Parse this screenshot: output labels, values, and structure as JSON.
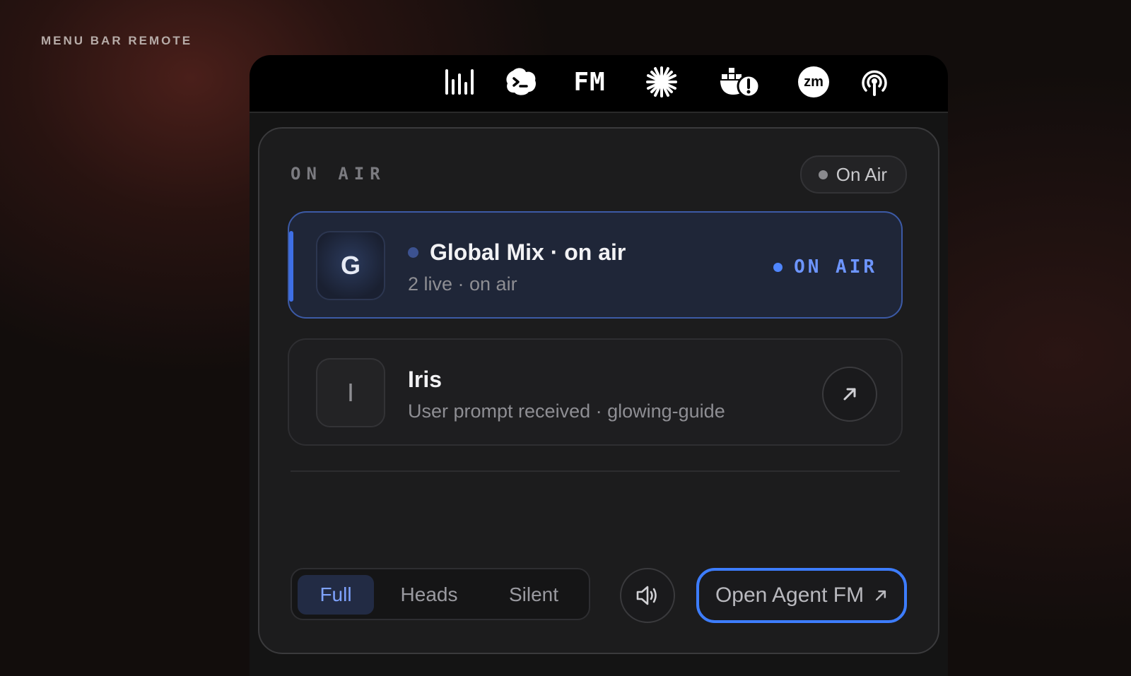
{
  "page_label": "MENU BAR REMOTE",
  "menubar": {
    "icons": [
      "audio-levels-icon",
      "terminal-cloud-icon",
      "fm-logo-icon",
      "sparkle-burst-icon",
      "docker-alert-icon",
      "zoom-icon",
      "podcast-broadcast-icon"
    ],
    "fm_text": "FM",
    "zoom_text": "zm"
  },
  "panel": {
    "section_title": "ON AIR",
    "status_pill": "On Air",
    "rows": [
      {
        "avatar": "G",
        "title": "Global Mix · on air",
        "subtitle": "2 live · on air",
        "status": "ON AIR",
        "active": true
      },
      {
        "avatar": "I",
        "title": "Iris",
        "subtitle": "User prompt received · glowing-guide",
        "action_icon": "arrow-up-right-icon",
        "active": false
      }
    ],
    "modes": [
      "Full",
      "Heads",
      "Silent"
    ],
    "selected_mode": "Full",
    "open_button": "Open Agent FM"
  },
  "colors": {
    "accent": "#3d7dff",
    "on_air_text": "#6d95ff",
    "active_row_bg": "#1f2638"
  }
}
